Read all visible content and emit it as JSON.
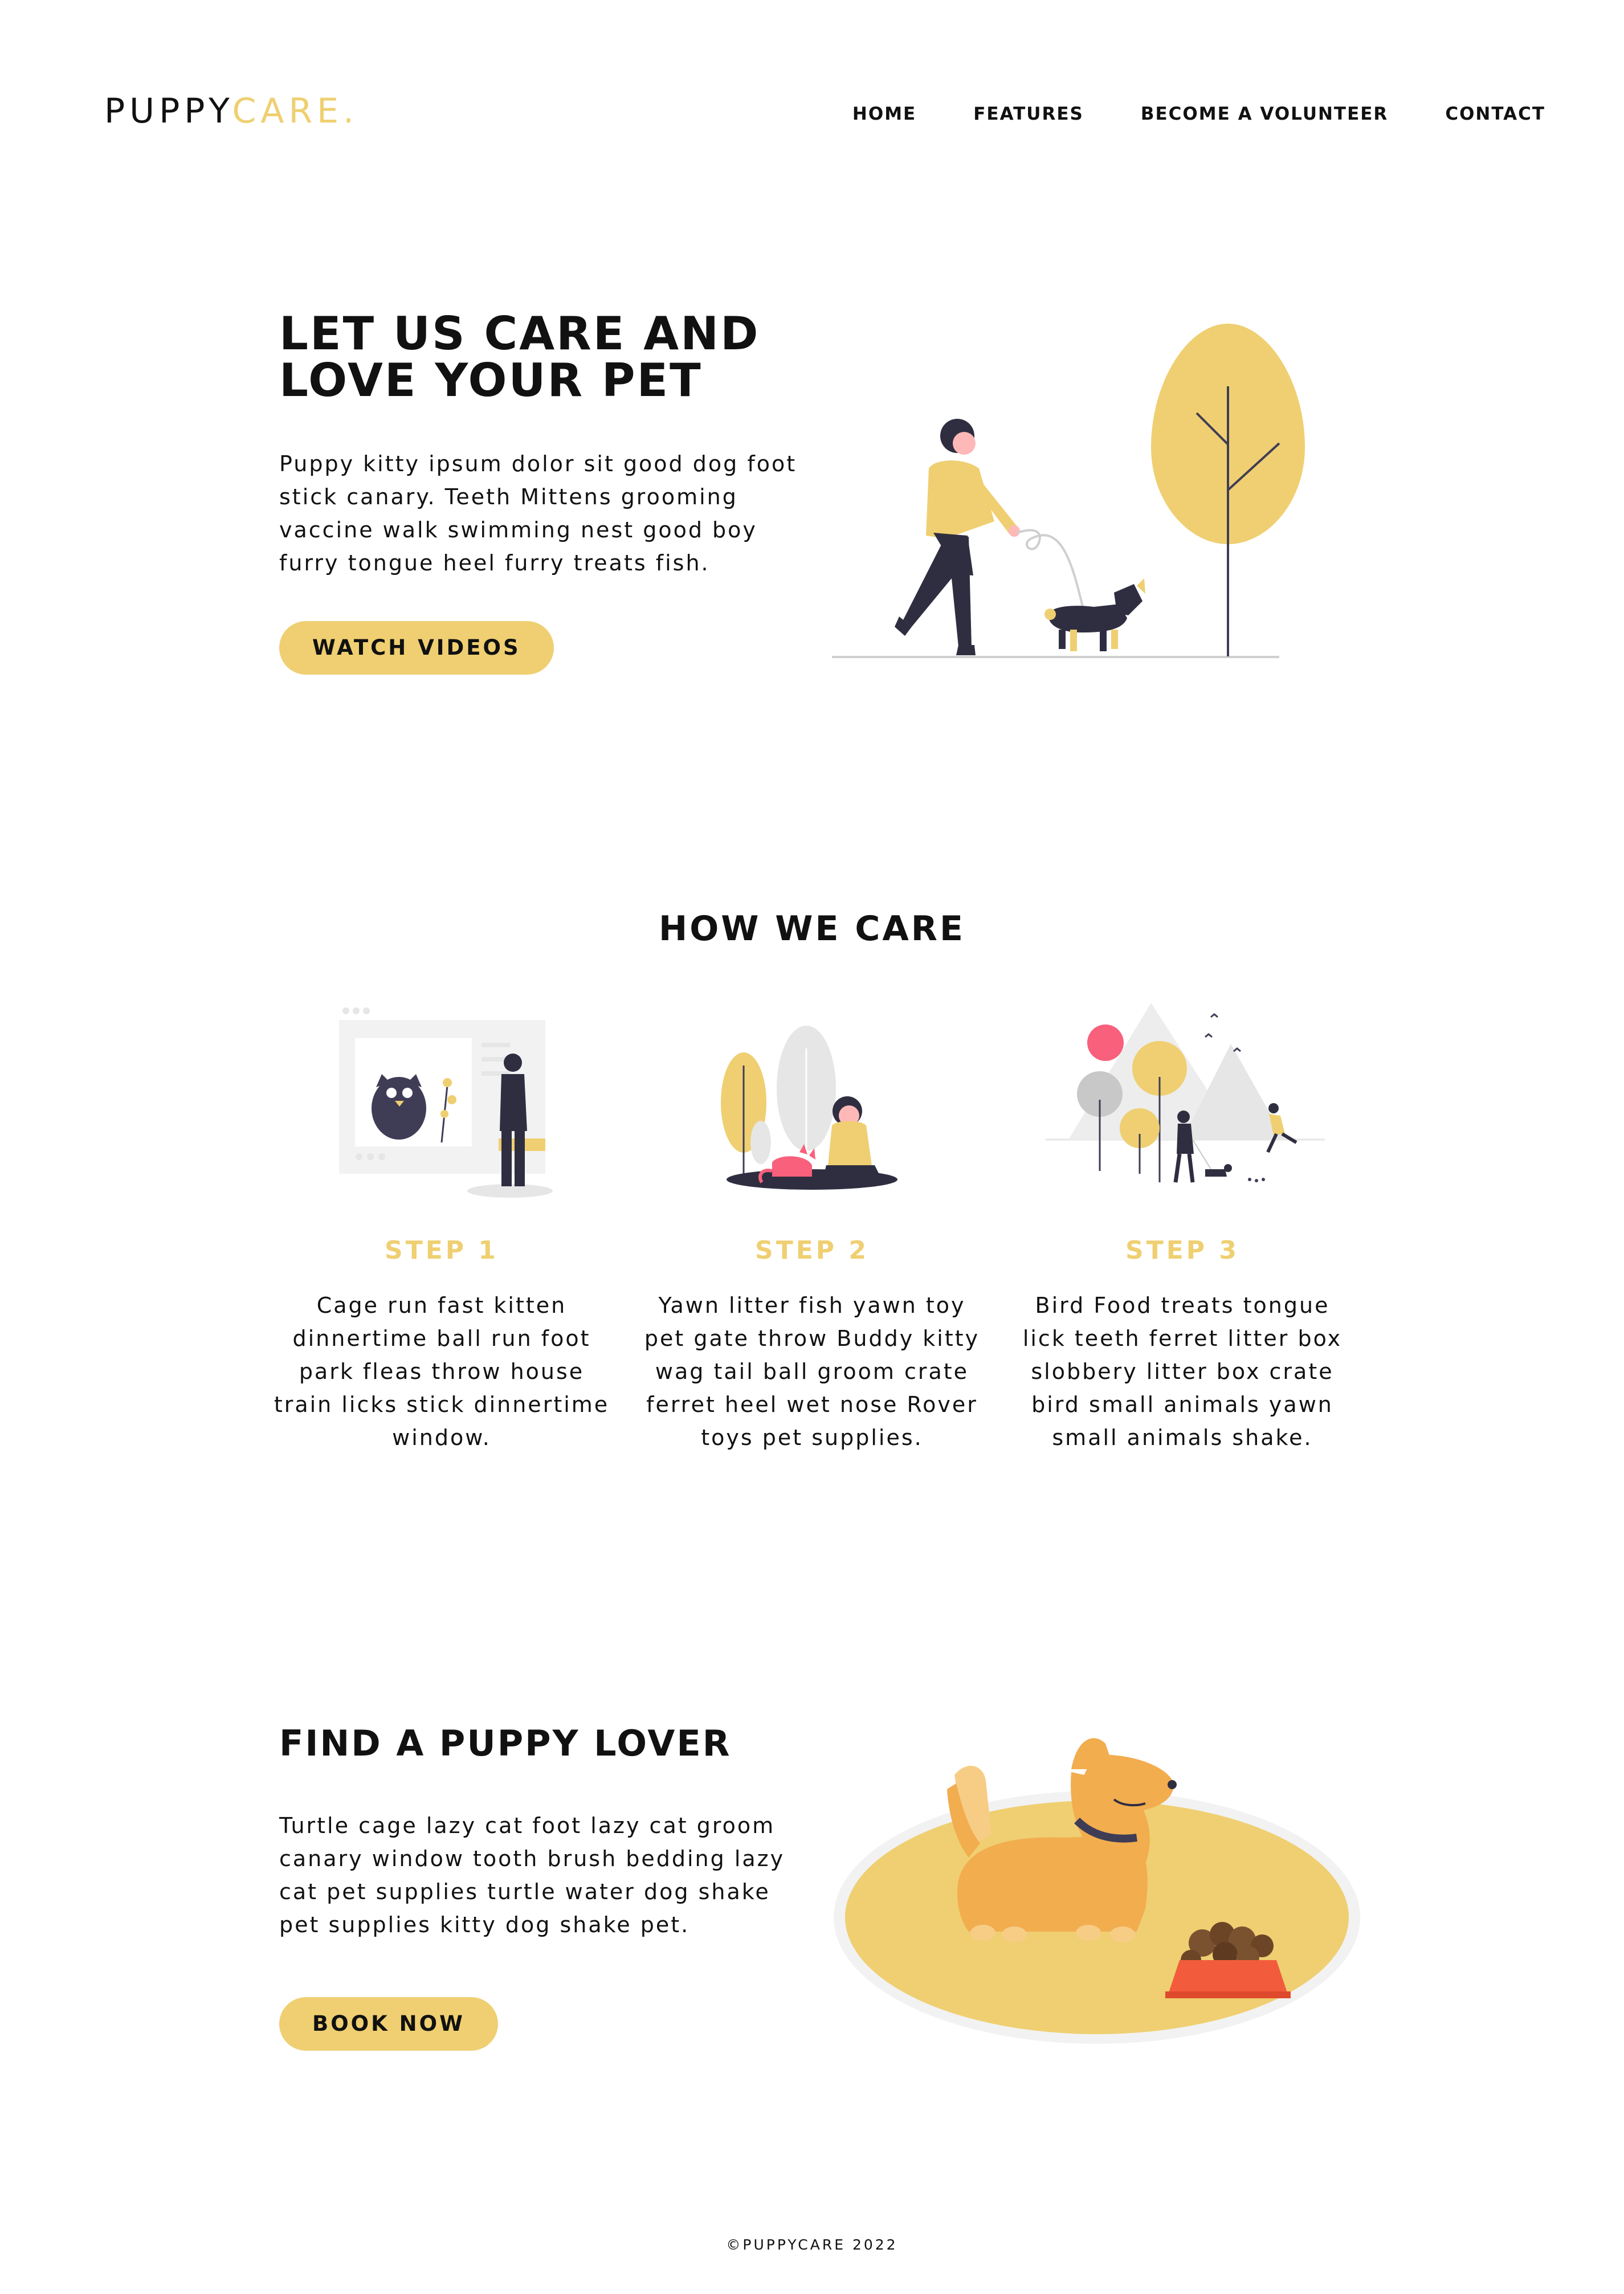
{
  "header": {
    "logo_primary": "PUPPY",
    "logo_accent": "CARE.",
    "nav": [
      "HOME",
      "FEATURES",
      "BECOME A VOLUNTEER",
      "CONTACT"
    ]
  },
  "hero": {
    "title": "LET US CARE AND LOVE YOUR PET",
    "text": "Puppy kitty ipsum dolor sit good dog foot stick canary. Teeth Mittens grooming vaccine walk swimming nest good boy furry tongue heel furry treats fish.",
    "button": "WATCH VIDEOS",
    "illustration_icon": "man-walking-dog-illustration"
  },
  "how_we_care": {
    "title": "HOW WE CARE",
    "steps": [
      {
        "label": "STEP 1",
        "text": "Cage run fast kitten dinnertime ball run foot park fleas throw house train licks stick dinnertime window.",
        "icon": "cat-on-screen-illustration"
      },
      {
        "label": "STEP 2",
        "text": "Yawn litter fish yawn toy pet gate throw Buddy kitty wag tail ball groom crate ferret heel wet nose Rover toys pet supplies.",
        "icon": "girl-with-cat-illustration"
      },
      {
        "label": "STEP 3",
        "text": "Bird Food treats tongue lick teeth ferret litter box slobbery litter box crate bird small animals yawn small animals shake.",
        "icon": "dog-walk-park-illustration"
      }
    ]
  },
  "puppy_lover": {
    "title": "FIND A PUPPY LOVER",
    "text": "Turtle cage lazy cat foot lazy cat groom canary window tooth brush bedding lazy cat pet supplies turtle water dog shake pet supplies kitty dog shake pet.",
    "button": "BOOK NOW",
    "illustration_icon": "dog-with-food-bowl-illustration"
  },
  "footer": {
    "text": "©PUPPYCARE 2022"
  },
  "colors": {
    "accent": "#efcf71",
    "dark": "#2f2e41",
    "pink": "#f8607c",
    "dog_orange": "#f2ad4f",
    "bowl_red": "#f25c3c"
  }
}
